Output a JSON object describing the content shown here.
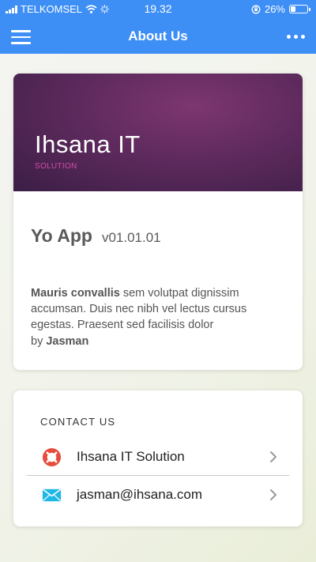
{
  "status_bar": {
    "carrier": "TELKOMSEL",
    "time": "19.32",
    "battery_percent": "26%",
    "battery_level": 0.26
  },
  "nav": {
    "title": "About Us"
  },
  "about_card": {
    "brand_title": "Ihsana IT",
    "brand_subtitle": "SOLUTION",
    "app_name": "Yo App",
    "app_version": "v01.01.01",
    "description_bold": "Mauris convallis",
    "description_text": " sem volutpat dignissim accumsan. Duis nec nibh vel lectus cursus egestas. Praesent sed facilisis dolor",
    "by_prefix": "by ",
    "author": "Jasman"
  },
  "contact_card": {
    "heading": "CONTACT US",
    "items": [
      {
        "label": "Ihsana IT Solution",
        "icon": "lifebuoy-icon",
        "icon_color": "#e74c3c"
      },
      {
        "label": "jasman@ihsana.com",
        "icon": "envelope-icon",
        "icon_color": "#1fb8e6"
      }
    ]
  },
  "colors": {
    "nav_bar": "#3d8ef5",
    "banner": "#5e2a5d",
    "brand_subtitle": "#d04da7"
  }
}
